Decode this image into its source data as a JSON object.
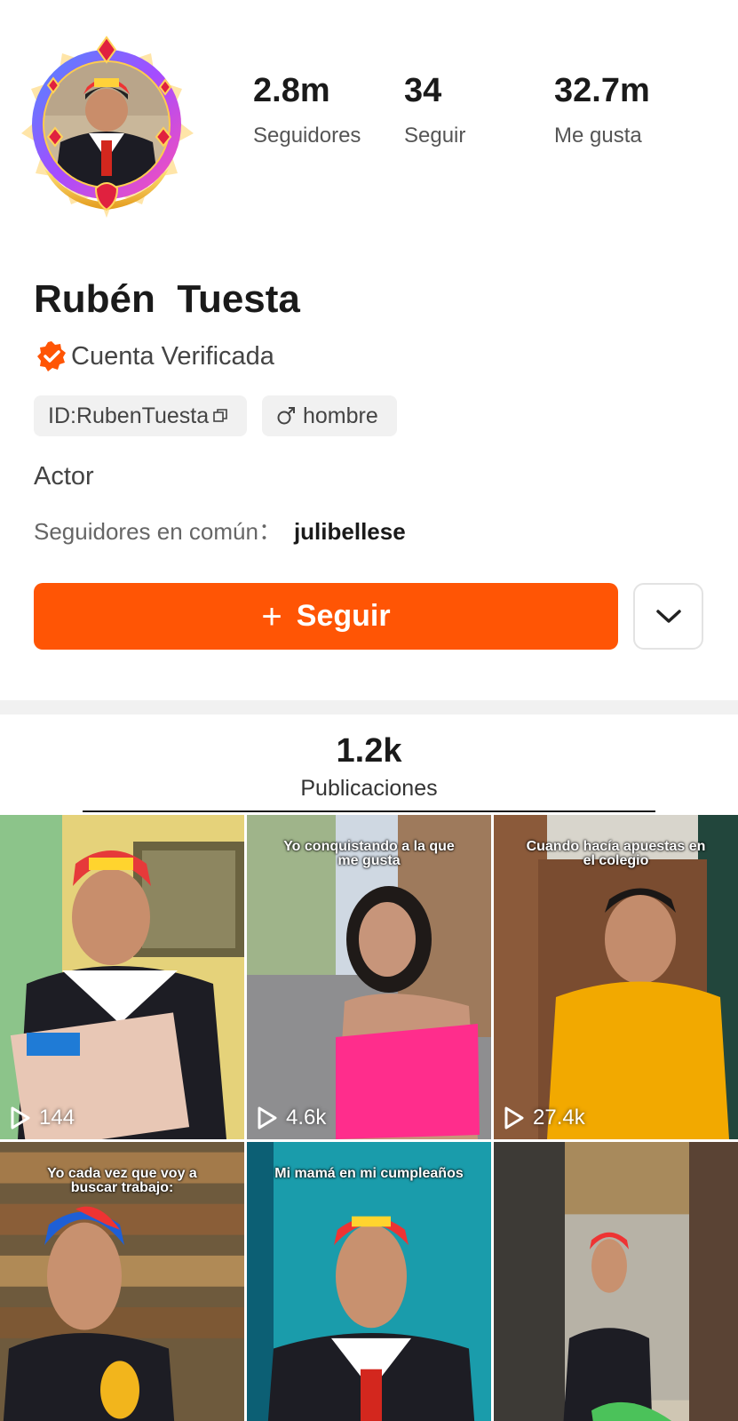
{
  "profile": {
    "name": "Rubén  Tuesta",
    "verified_label": "Cuenta Verificada",
    "id_label": "ID:RubenTuesta",
    "gender_label": "hombre",
    "bio": "Actor",
    "mutual_label": "Seguidores en común：",
    "mutual_user": "julibellese"
  },
  "stats": {
    "followers": {
      "value": "2.8m",
      "label": "Seguidores"
    },
    "following": {
      "value": "34",
      "label": "Seguir"
    },
    "likes": {
      "value": "32.7m",
      "label": "Me gusta"
    }
  },
  "actions": {
    "follow_label": "Seguir",
    "follow_icon": "plus-icon",
    "more_icon": "chevron-down-icon"
  },
  "tabs": {
    "publications_count": "1.2k",
    "publications_label": "Publicaciones"
  },
  "videos": [
    {
      "caption": "",
      "views": "144"
    },
    {
      "caption": "Yo conquistando a la que me gusta",
      "views": "4.6k"
    },
    {
      "caption": "Cuando hacía apuestas en el colegio",
      "views": "27.4k"
    },
    {
      "caption": "Yo cada vez que voy a buscar trabajo:",
      "views": ""
    },
    {
      "caption": "Mi mamá en mi cumpleaños",
      "views": ""
    },
    {
      "caption": "",
      "views": ""
    }
  ],
  "colors": {
    "accent": "#ff5505",
    "verified_badge": "#ff5505",
    "tag_bg": "#f1f1f1"
  }
}
